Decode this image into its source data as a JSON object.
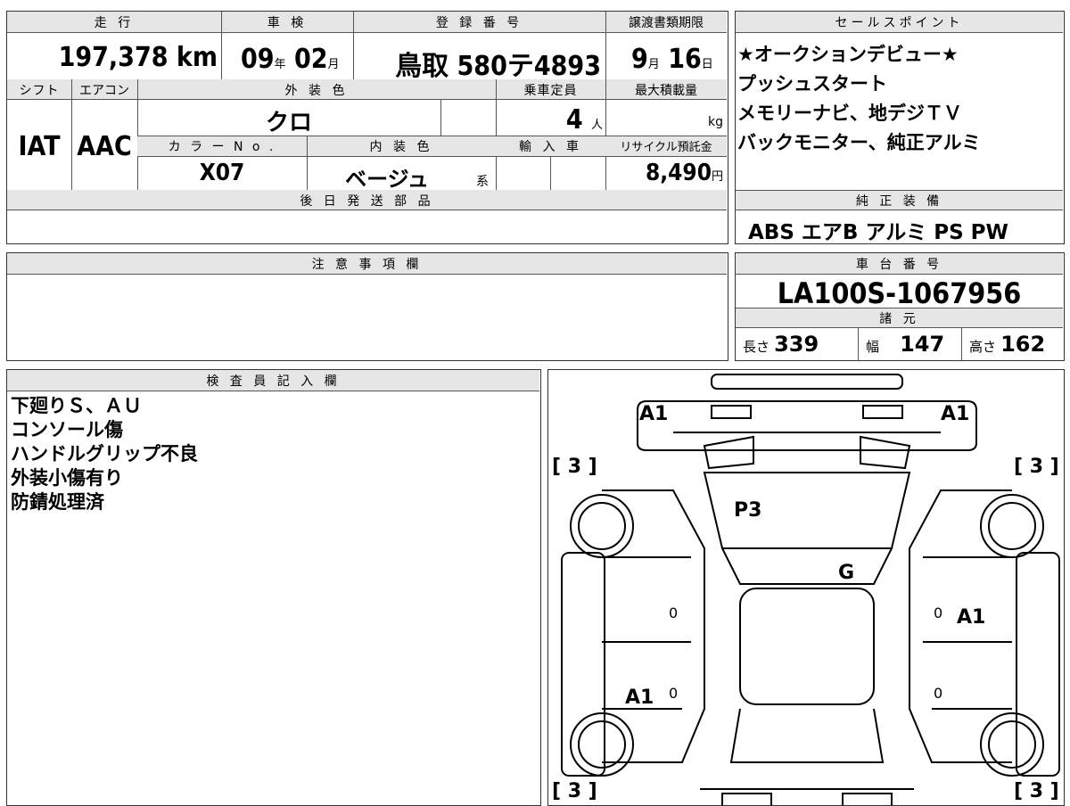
{
  "top": {
    "headers": {
      "mileage": "走 行",
      "shaken": "車 検",
      "registration": "登 録 番 号",
      "transfer_deadline": "譲渡書類期限"
    },
    "mileage_value": "197,378",
    "mileage_unit": "km",
    "shaken_year": "09",
    "shaken_year_unit": "年",
    "shaken_month": "02",
    "shaken_month_unit": "月",
    "plate": "鳥取 580テ4893",
    "deadline_month": "9",
    "deadline_month_unit": "月",
    "deadline_day": "16",
    "deadline_day_unit": "日"
  },
  "row2": {
    "headers": {
      "shift": "シフト",
      "aircon": "エアコン",
      "exterior_color": "外 装 色",
      "capacity": "乗車定員",
      "max_load": "最大積載量",
      "color_no": "カ ラ ー N o .",
      "interior_color": "内 装 色",
      "import": "輸 入 車",
      "recycle": "リサイクル預託金"
    },
    "shift_value": "IAT",
    "aircon_value": "AAC",
    "exterior_color_value": "クロ",
    "capacity_value": "4",
    "capacity_unit": "人",
    "max_load_unit": "kg",
    "color_no_value": "X07",
    "interior_color_value": "ベージュ",
    "interior_color_suffix": "系",
    "recycle_value": "8,490",
    "recycle_unit": "円"
  },
  "sales_points": {
    "header": "セールスポイント",
    "lines": [
      "★オークションデビュー★",
      "プッシュスタート",
      "メモリーナビ、地デジＴＶ",
      "バックモニター、純正アルミ"
    ]
  },
  "later_parts": {
    "header": "後 日 発 送 部 品",
    "value": ""
  },
  "equipment": {
    "header": "純 正 装 備",
    "value": "ABS エアB アルミ PS PW"
  },
  "notes": {
    "header": "注 意 事 項 欄",
    "value": ""
  },
  "chassis": {
    "header": "車 台 番 号",
    "value": "LA100S-1067956"
  },
  "specs": {
    "header": "諸 元",
    "length_label": "長さ",
    "length_value": "339",
    "width_label": "幅",
    "width_value": "147",
    "height_label": "高さ",
    "height_value": "162"
  },
  "inspector": {
    "header": "検 査 員 記 入 欄",
    "remarks": [
      "下廻りＳ、ＡＵ",
      "コンソール傷",
      "ハンドルグリップ不良",
      "外装小傷有り",
      "防錆処理済"
    ]
  },
  "diagram": {
    "marks": {
      "front_left": "A1",
      "front_right": "A1",
      "tire_fl": "[ 3 ]",
      "tire_fr": "[ 3 ]",
      "tire_rl": "[ 3 ]",
      "tire_rr": "[ 3 ]",
      "roof": "P3",
      "windshield": "G",
      "door_right": "A1",
      "door_left_rear": "A1",
      "zero_1": "0",
      "zero_2": "0",
      "zero_3": "0",
      "zero_4": "0"
    }
  }
}
